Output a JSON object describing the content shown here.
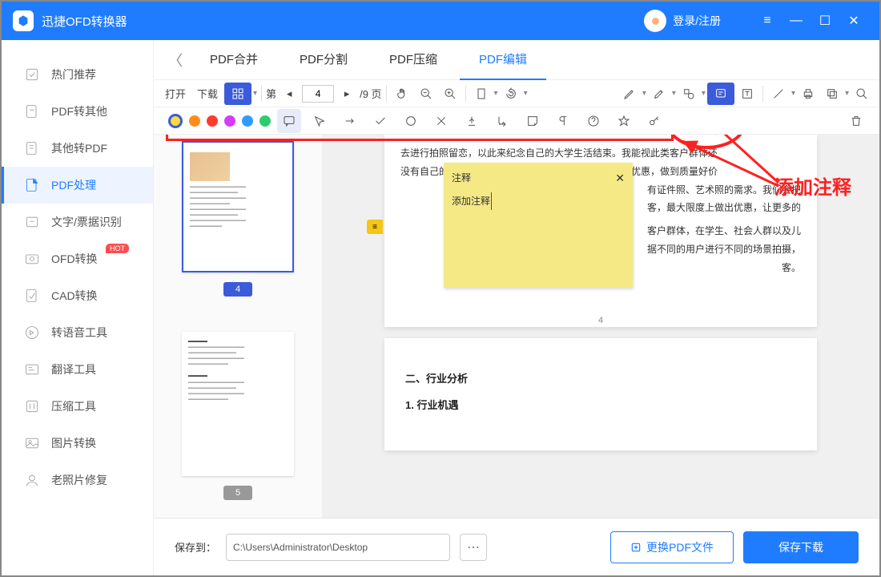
{
  "app": {
    "title": "迅捷OFD转换器",
    "login": "登录/注册"
  },
  "sidebar": {
    "items": [
      {
        "label": "热门推荐"
      },
      {
        "label": "PDF转其他"
      },
      {
        "label": "其他转PDF"
      },
      {
        "label": "PDF处理"
      },
      {
        "label": "文字/票据识别"
      },
      {
        "label": "OFD转换",
        "hot": "HOT"
      },
      {
        "label": "CAD转换"
      },
      {
        "label": "转语音工具"
      },
      {
        "label": "翻译工具"
      },
      {
        "label": "压缩工具"
      },
      {
        "label": "图片转换"
      },
      {
        "label": "老照片修复"
      }
    ],
    "active_index": 3
  },
  "tabs": {
    "items": [
      {
        "label": "PDF合并"
      },
      {
        "label": "PDF分割"
      },
      {
        "label": "PDF压缩"
      },
      {
        "label": "PDF编辑"
      }
    ],
    "active_index": 3
  },
  "toolbar": {
    "open": "打开",
    "download": "下载",
    "page_label": "第",
    "current_page": "4",
    "total_pages": "/9 页"
  },
  "sticky": {
    "title": "注释",
    "body": "添加注释"
  },
  "preview": {
    "page4": {
      "line1": "去进行拍照留恋，以此来纪念自己的大学生活结束。我能视此类客户群体还",
      "line2": "没有自己的稳定收入来源，我们会在价格上进行一定的优惠，做到质量好价",
      "line3": "有证件照、艺术照的需求。我们会把",
      "line4": "客，最大限度上做出优惠，让更多的",
      "line5": "客户群体，在学生、社会人群以及儿",
      "line6": "据不同的用户进行不同的场景拍摄，",
      "line7": "客。",
      "number": "4"
    },
    "page5": {
      "heading": "二、行业分析",
      "sub": "1. 行业机遇"
    }
  },
  "thumbs": {
    "p4": "4",
    "p5": "5"
  },
  "footer": {
    "save_to": "保存到：",
    "path": "C:\\Users\\Administrator\\Desktop",
    "change": "更换PDF文件",
    "download": "保存下载"
  },
  "callout": "添加注释"
}
